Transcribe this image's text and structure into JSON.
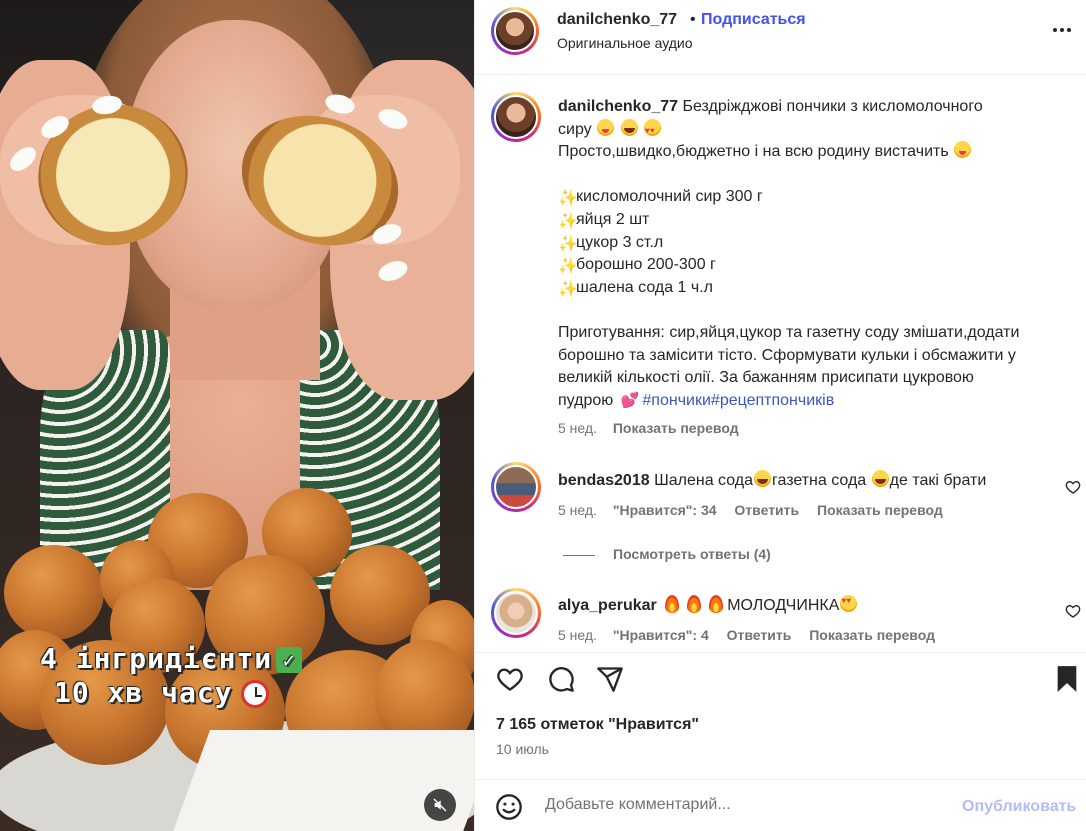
{
  "media": {
    "overlay_line1": "4 інгридієнти",
    "overlay_line2": "10 хв часу",
    "mute_icon": "speaker-muted-icon"
  },
  "header": {
    "username": "danilchenko_77",
    "separator": "•",
    "follow_label": "Подписаться",
    "audio_label": "Оригинальное аудио",
    "more_icon": "more-options-icon"
  },
  "caption": {
    "username": "danilchenko_77",
    "line1": "Бездріжджові пончики з кисломолочного",
    "line2": "сиру",
    "line3": "Просто,швидко,бюджетно і на всю родину вистачить",
    "ingredients": [
      "кисломолочний сир 300 г",
      "яйця 2 шт",
      "цукор 3 ст.л",
      "борошно 200-300 г",
      "шалена сода 1 ч.л"
    ],
    "prep_lines": [
      "Приготування: сир,яйця,цукор та газетну соду змішати,додати",
      "борошно та замісити тісто. Сформувати кульки і обсмажити у",
      "великій кількості олії. За бажанням присипати цукровою",
      "пудрою"
    ],
    "hashtags": "#пончики#рецептпончиків",
    "time": "5 нед.",
    "translate": "Показать перевод"
  },
  "comments": [
    {
      "username": "bendas2018",
      "text_parts": [
        "Шалена сода",
        "газетна сода",
        "де такі брати"
      ],
      "time": "5 нед.",
      "likes": "\"Нравится\": 34",
      "reply": "Ответить",
      "translate": "Показать перевод",
      "view_replies": "Посмотреть ответы (4)"
    },
    {
      "username": "alya_perukar",
      "text": "МОЛОДЧИНКА",
      "time": "5 нед.",
      "likes": "\"Нравится\": 4",
      "reply": "Ответить",
      "translate": "Показать перевод"
    }
  ],
  "actions": {
    "like_icon": "heart-icon",
    "comment_icon": "comment-icon",
    "share_icon": "share-icon",
    "save_icon": "bookmark-icon",
    "likes_count": "7 165 отметок \"Нравится\"",
    "date": "10 июль"
  },
  "add_comment": {
    "placeholder": "Добавьте комментарий...",
    "publish_label": "Опубликовать",
    "emoji_icon": "emoji-icon"
  },
  "colors": {
    "follow_blue": "#4150f7",
    "hashtag_blue": "#3a55c8",
    "publish_disabled": "#b2bcf8",
    "muted_text": "#737373"
  }
}
